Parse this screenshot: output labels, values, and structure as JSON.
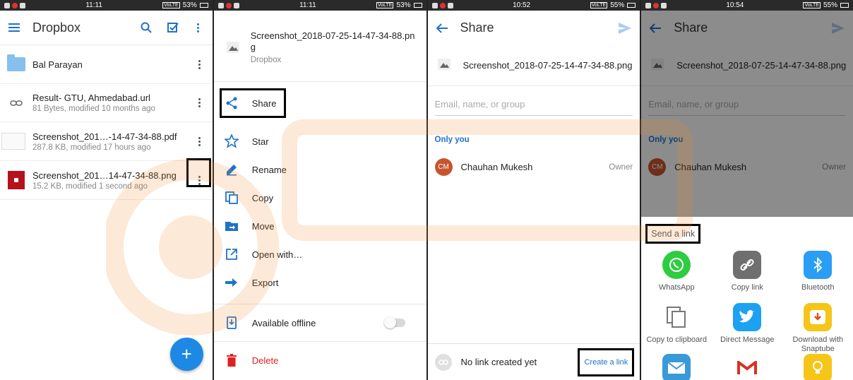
{
  "status_bars": [
    {
      "time": "11:11",
      "battery": "53%",
      "volte": "VoLTE"
    },
    {
      "time": "11:11",
      "battery": "53%",
      "volte": "VoLTE"
    },
    {
      "time": "10:52",
      "battery": "55%",
      "volte": "VoLTE"
    },
    {
      "time": "10:54",
      "battery": "55%",
      "volte": "VoLTE"
    }
  ],
  "dropbox_list": {
    "title": "Dropbox",
    "icons": [
      "menu-icon",
      "search-icon",
      "select-icon",
      "overflow-icon"
    ],
    "items": [
      {
        "name": "Bal Parayan",
        "meta": "",
        "type": "folder"
      },
      {
        "name": "Result- GTU, Ahmedabad.url",
        "meta": "81 Bytes, modified 10 months ago",
        "type": "link"
      },
      {
        "name": "Screenshot_201…-14-47-34-88.pdf",
        "meta": "287.8 KB, modified 17 hours ago",
        "type": "pdf"
      },
      {
        "name": "Screenshot_201…14-47-34-88.png",
        "meta": "15.2 KB, modified 1 second ago",
        "type": "image"
      }
    ],
    "fab_label": "+"
  },
  "action_menu": {
    "file_name": "Screenshot_2018-07-25-14-47-34-88.png",
    "location": "Dropbox",
    "items": [
      {
        "label": "Share",
        "icon": "share-icon"
      },
      {
        "label": "Star",
        "icon": "star-icon"
      },
      {
        "label": "Rename",
        "icon": "pencil-icon"
      },
      {
        "label": "Copy",
        "icon": "copy-icon"
      },
      {
        "label": "Move",
        "icon": "move-folder-icon"
      },
      {
        "label": "Open with…",
        "icon": "open-external-icon"
      },
      {
        "label": "Export",
        "icon": "export-arrow-icon"
      }
    ],
    "offline_label": "Available offline",
    "delete_label": "Delete"
  },
  "share_screen": {
    "title": "Share",
    "file_name": "Screenshot_2018-07-25-14-47-34-88.png",
    "email_placeholder": "Email, name, or group",
    "only_you": "Only you",
    "member": {
      "initials": "CM",
      "name": "Chauhan Mukesh",
      "role": "Owner"
    },
    "no_link": "No link created yet",
    "create_link": "Create a link"
  },
  "send_link_sheet": {
    "title": "Send a link",
    "apps": [
      {
        "label": "WhatsApp",
        "icon": "whatsapp-icon",
        "color": "#2ecc40"
      },
      {
        "label": "Copy link",
        "icon": "link-icon",
        "color": "#6f6f6f"
      },
      {
        "label": "Bluetooth",
        "icon": "bluetooth-icon",
        "color": "#2a9df4"
      },
      {
        "label": "Copy to clipboard",
        "icon": "clipboard-icon",
        "color": "#ffffff"
      },
      {
        "label": "Direct Message",
        "icon": "twitter-icon",
        "color": "#1da1f2"
      },
      {
        "label": "Download with Snaptube",
        "icon": "snaptube-icon",
        "color": "#f5c518"
      },
      {
        "label": "",
        "icon": "email-icon",
        "color": "#3a9ad9"
      },
      {
        "label": "",
        "icon": "gmail-icon",
        "color": "#ffffff"
      },
      {
        "label": "",
        "icon": "bulb-icon",
        "color": "#f5c518"
      }
    ]
  },
  "colors": {
    "accent": "#1e72c8",
    "fab": "#1e88e5",
    "delete": "#e02020",
    "avatar": "#c8542f"
  }
}
